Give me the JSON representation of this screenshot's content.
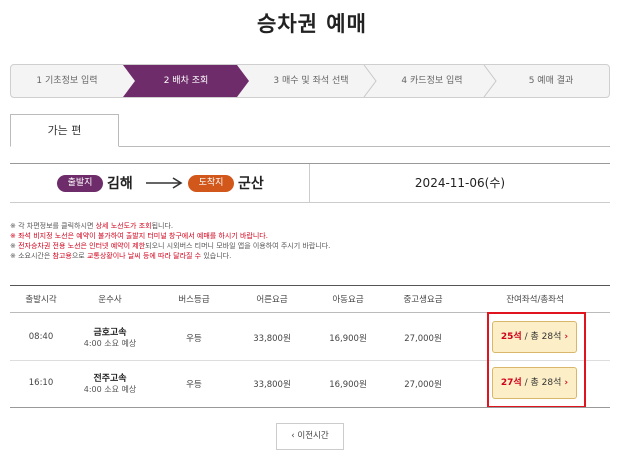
{
  "page_title": "승차권 예매",
  "steps": [
    {
      "label": "1 기초정보 입력"
    },
    {
      "label": "2 배차 조회"
    },
    {
      "label": "3 매수 및 좌석 선택"
    },
    {
      "label": "4 카드정보 입력"
    },
    {
      "label": "5 예매 결과"
    }
  ],
  "active_step": 2,
  "tab": {
    "label": "가는 편"
  },
  "route": {
    "departure_badge": "출발지",
    "departure": "김해",
    "arrival_badge": "도착지",
    "arrival": "군산",
    "date": "2024-11-06(수)"
  },
  "notices": {
    "n1_a": "※ 각 차편정보를 클릭하시면 ",
    "n1_b": "상세 노선도가 조회",
    "n1_c": "됩니다.",
    "n2": "※ 좌석 비지정 노선은 예약이 불가하여 출발지 터미널 창구에서 예매를 하시기 바랍니다.",
    "n3_a": "※ ",
    "n3_b": "전자승차권 전용 노선은 인터넷 예약이 제한",
    "n3_c": "되오니 시외버스 티머니 모바일 앱을 이용하여 주시기 바랍니다.",
    "n4_a": "※ 소요시간은 ",
    "n4_b": "참고용",
    "n4_c": "으로 ",
    "n4_d": "교통상황이나 날씨 등에 따라 달라질 수",
    "n4_e": " 있습니다."
  },
  "table": {
    "headers": [
      "출발시각",
      "운수사",
      "버스등급",
      "어른요금",
      "아동요금",
      "중고생요금",
      "잔여좌석/총좌석"
    ],
    "rows": [
      {
        "time": "08:40",
        "company": "금호고속",
        "duration": "4:00 소요 예상",
        "grade": "우등",
        "adult": "33,800원",
        "child": "16,900원",
        "student": "27,000원",
        "remaining": "25석",
        "total": " / 총 28석"
      },
      {
        "time": "16:10",
        "company": "전주고속",
        "duration": "4:00 소요 예상",
        "grade": "우등",
        "adult": "33,800원",
        "child": "16,900원",
        "student": "27,000원",
        "remaining": "27석",
        "total": " / 총 28석"
      }
    ]
  },
  "prev_button": "이전시간",
  "colors": {
    "active_step": "#6e2c6a",
    "departure": "#6e2c6a",
    "arrival": "#d1571b",
    "accent_red": "#d0021b",
    "seat_bg": "#fcefc7"
  }
}
